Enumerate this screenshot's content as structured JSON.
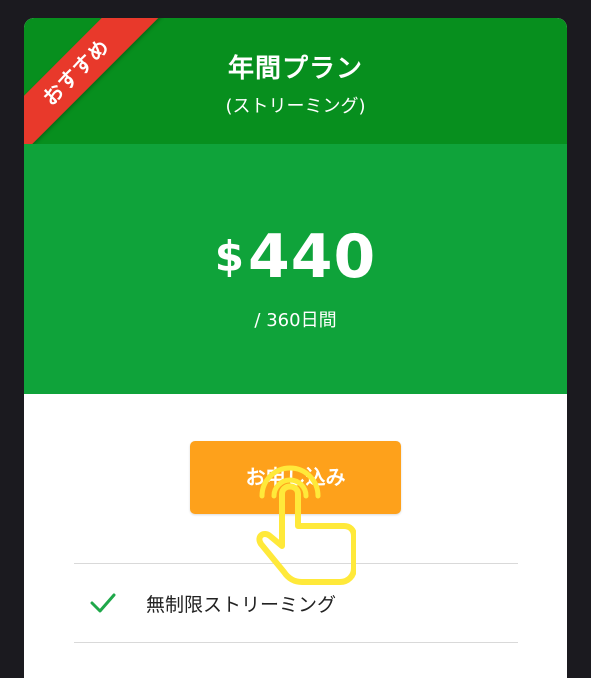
{
  "plan": {
    "badge": "おすすめ",
    "title": "年間プラン",
    "subtitle": "(ストリーミング)",
    "currency": "$",
    "price": "440",
    "period": "/ 360日間",
    "apply_label": "お申し込み",
    "features": [
      {
        "label": "無制限ストリーミング",
        "icon": "check-icon"
      }
    ]
  },
  "colors": {
    "background": "#1b1a1f",
    "header_green": "#078f1e",
    "price_green": "#0fa33a",
    "badge_red": "#e8392b",
    "button_orange": "#fea11b",
    "check_green": "#1fa84a",
    "cursor_yellow": "#ffe93a"
  }
}
